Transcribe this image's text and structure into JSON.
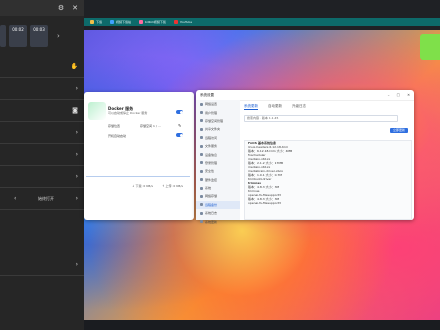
{
  "browser": {
    "bookmarks": [
      {
        "label": "下载",
        "color": "#f0c04a"
      },
      {
        "label": "视频下载站",
        "color": "#40a0ff"
      },
      {
        "label": "bilibili视频下载",
        "color": "#ff6aa0"
      },
      {
        "label": "YouTube",
        "color": "#e33"
      }
    ]
  },
  "panel": {
    "settings_icon": "gear-icon",
    "close_icon": "close-icon",
    "thumbs": [
      "00:02",
      "00:03"
    ],
    "open_label": "始终打开"
  },
  "docker": {
    "title": "Docker 服务",
    "subtitle": "可以启动或停止 Docker 服务",
    "opt1": "存储位置",
    "opt1_value": "存储空间 1 / ...",
    "opt2": "开机自动启动",
    "status_down": "↓ 下载: 0 KB/s",
    "status_up": "↑ 上传: 0 KB/s"
  },
  "syswin": {
    "title": "系统设置",
    "sidebar": [
      "网络设置",
      "用户管理",
      "存储空间管理",
      "共享文件夹",
      "远程访问",
      "文件服务",
      "设备信息",
      "登录管理",
      "安全性",
      "硬件监控",
      "系统",
      "网络存储",
      "远程备份",
      "系统日志",
      "系统更新"
    ],
    "active_index": 12,
    "tabs": [
      "系统更新",
      "自动更新",
      "升级日志"
    ],
    "search_placeholder": "搜索内容 · 版本 1.1.45",
    "update_button": "立即更新",
    "info": [
      {
        "text": "FnOS 基本系统信息",
        "h": true
      },
      {
        "text": "linux-headers 6.12.18-trim"
      },
      {
        "text": "版本：6.12.18-trim  大小：4MB"
      },
      {
        "text": "fnscheduler"
      },
      {
        "text": "mediaio-x61xx"
      },
      {
        "text": "版本：2.1.2  大小：17MB"
      },
      {
        "text": "mediaio-x61xx"
      },
      {
        "text": "mediabrain-driver-xbox"
      },
      {
        "text": "版本：1.0.1  大小：0.7M"
      },
      {
        "text": "trimbuild-driver"
      },
      {
        "text": "trimnas",
        "h": true
      },
      {
        "text": "版本：4.8.3  大小：3M"
      },
      {
        "text": "trimnas"
      },
      {
        "text": "openai-fs-filesupport3"
      },
      {
        "text": "版本：4.8.3  大小：3M"
      },
      {
        "text": "openai-fs-filesupport3"
      }
    ]
  }
}
